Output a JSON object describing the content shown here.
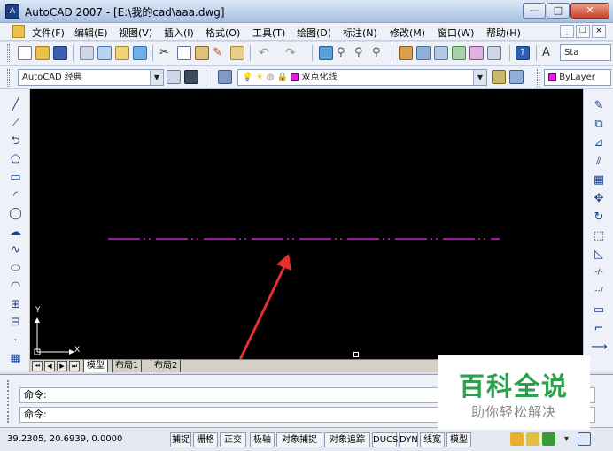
{
  "window": {
    "title": "AutoCAD 2007 - [E:\\我的cad\\aaa.dwg]",
    "app_icon_text": "A",
    "controls": [
      "minimize-icon",
      "maximize-icon",
      "close-icon"
    ],
    "min_glyph": "—",
    "max_glyph": "□",
    "close_glyph": "✕"
  },
  "menu": {
    "items": [
      "文件(F)",
      "编辑(E)",
      "视图(V)",
      "插入(I)",
      "格式(O)",
      "工具(T)",
      "绘图(D)",
      "标注(N)",
      "修改(M)",
      "窗口(W)",
      "帮助(H)"
    ],
    "mdi_min": "_",
    "mdi_restore": "❐",
    "mdi_close": "×"
  },
  "toolbar_standard": {
    "style_label": "Sta"
  },
  "toolbar_props": {
    "workspace": "AutoCAD 经典",
    "layer_name": "双点化线",
    "color_label": "ByLayer"
  },
  "left_tools": [
    "line-icon",
    "construction-line-icon",
    "polyline-icon",
    "polygon-icon",
    "rectangle-icon",
    "arc-icon",
    "circle-icon",
    "revcloud-icon",
    "spline-icon",
    "ellipse-icon",
    "ellipse-arc-icon",
    "insert-block-icon",
    "make-block-icon",
    "point-icon",
    "hatch-icon"
  ],
  "left_glyphs": [
    "╱",
    "⟋",
    "⮌",
    "⬠",
    "▭",
    "◜",
    "◯",
    "☁",
    "∿",
    "⬭",
    "◠",
    "⊞",
    "⊟",
    "·",
    "▦"
  ],
  "right_tools": [
    "erase-icon",
    "copy-icon",
    "mirror-icon",
    "offset-icon",
    "array-icon",
    "move-icon",
    "rotate-icon",
    "scale-icon",
    "stretch-icon",
    "trim-icon",
    "extend-icon",
    "break-icon",
    "join-icon",
    "chamfer-icon"
  ],
  "right_glyphs": [
    "✎",
    "⧉",
    "⊿",
    "⫽",
    "▦",
    "✥",
    "↻",
    "⬚",
    "◺",
    "-/-",
    "--/",
    "▭",
    "⌐",
    "⟶"
  ],
  "canvas": {
    "background": "#000000",
    "line_color": "#d020d0",
    "arrow_color": "#e03030",
    "ucs_y": "Y",
    "ucs_x": "X"
  },
  "layout_tabs": {
    "nav": [
      "⏮",
      "◀",
      "▶",
      "⏭"
    ],
    "tabs": [
      "模型",
      "布局1",
      "布局2"
    ],
    "active": "模型"
  },
  "command": {
    "line1": "命令:",
    "line2": "命令:"
  },
  "status": {
    "coords": "39.2305, 20.6939, 0.0000",
    "buttons": [
      "捕捉",
      "栅格",
      "正交",
      "极轴",
      "对象捕捉",
      "对象追踪",
      "DUCS",
      "DYN",
      "线宽",
      "模型"
    ]
  },
  "watermark": {
    "title": "百科全说",
    "subtitle": "助你轻松解决"
  }
}
